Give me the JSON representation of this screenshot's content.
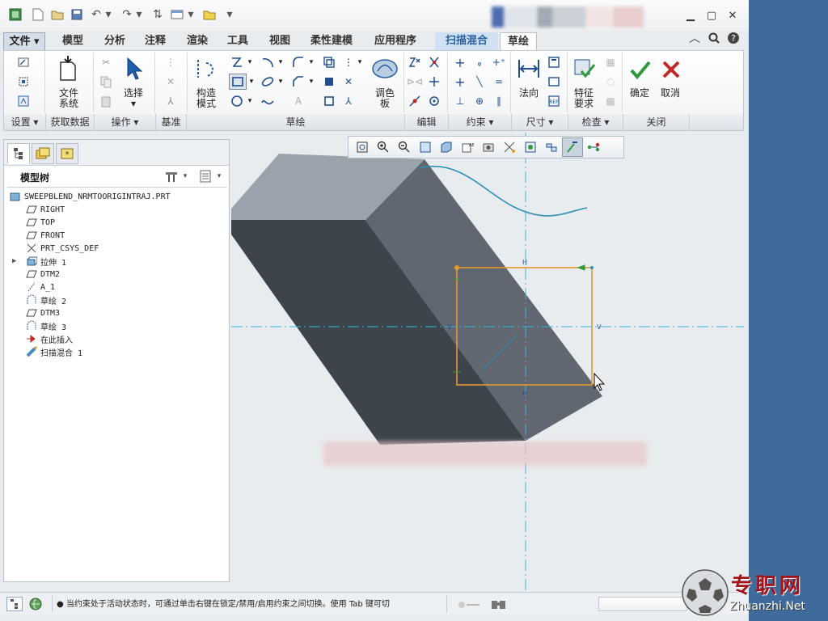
{
  "titlebar": {
    "tooltip_blur": ""
  },
  "menu": {
    "tabs": [
      {
        "label": "文件",
        "kind": "file"
      },
      {
        "label": "模型"
      },
      {
        "label": "分析"
      },
      {
        "label": "注释"
      },
      {
        "label": "渲染"
      },
      {
        "label": "工具"
      },
      {
        "label": "视图"
      },
      {
        "label": "柔性建模"
      },
      {
        "label": "应用程序"
      },
      {
        "label": "扫描混合",
        "kind": "sweep"
      },
      {
        "label": "草绘",
        "kind": "sketch"
      }
    ]
  },
  "ribbon": {
    "file_system": "文件\n系统",
    "select": "选择",
    "construct_mode": "构造\n模式",
    "palette": "调色\n板",
    "normal": "法向",
    "feature_req": "特征\n要求",
    "ok": "确定",
    "cancel": "取消",
    "groups": [
      "设置 ▾",
      "获取数据",
      "操作 ▾",
      "基准",
      "草绘",
      "编辑",
      "约束 ▾",
      "尺寸 ▾",
      "检查 ▾",
      "关闭"
    ]
  },
  "tree": {
    "title": "模型树",
    "items": [
      {
        "label": "SWEEPBLEND_NRMTOORIGINTRAJ.PRT",
        "icon": "part-icon"
      },
      {
        "label": "RIGHT",
        "icon": "datum-plane-icon"
      },
      {
        "label": "TOP",
        "icon": "datum-plane-icon"
      },
      {
        "label": "FRONT",
        "icon": "datum-plane-icon"
      },
      {
        "label": "PRT_CSYS_DEF",
        "icon": "csys-icon"
      },
      {
        "label": "拉伸 1",
        "icon": "extrude-icon",
        "expandable": true
      },
      {
        "label": "DTM2",
        "icon": "datum-plane-icon"
      },
      {
        "label": "A_1",
        "icon": "axis-icon"
      },
      {
        "label": "草绘 2",
        "icon": "sketch-icon"
      },
      {
        "label": "DTM3",
        "icon": "datum-plane-icon"
      },
      {
        "label": "草绘 3",
        "icon": "sketch-icon"
      },
      {
        "label": "在此插入",
        "icon": "insert-arrow-icon"
      },
      {
        "label": "扫描混合 1",
        "icon": "sweepblend-icon"
      }
    ]
  },
  "sketch": {
    "h_label": "H",
    "v_label": "V"
  },
  "status": {
    "message": "当约束处于活动状态时，可通过单击右键在锁定/禁用/启用约束之间切换。使用 Tab 键可切"
  },
  "watermark": {
    "text": "专职网",
    "url": "Zhuanzhi.Net"
  },
  "colors": {
    "accent": "#2a5f9e",
    "desktop": "#3e6b9b",
    "sketch": "#e39a2d",
    "ok": "#2e9a3a",
    "cancel": "#c0282a"
  }
}
